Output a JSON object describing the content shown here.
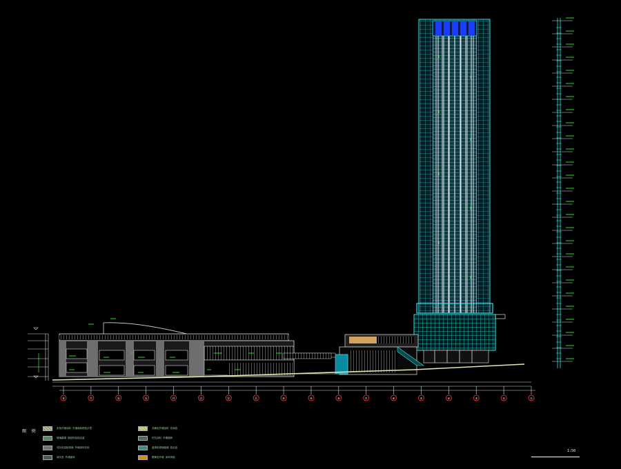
{
  "drawing": {
    "title": "",
    "scale": "1:50",
    "colors": {
      "background": "#000000",
      "tower_frame": "#2ee6e6",
      "tower_panel": "#c8c8c8",
      "crown": "#1a3cff",
      "podium_grey": "#6e6e6e",
      "green_line": "#22e022",
      "annotation": "#e8e8e8",
      "grid_circle": "#ff3b3b",
      "ground": "#e8e6b0"
    }
  },
  "axis_labels": [
    "⑱",
    "⑰",
    "⑯",
    "⑮",
    "⑭",
    "⑬",
    "⑫",
    "⑪",
    "⑩",
    "⑨",
    "⑧",
    "⑦",
    "⑥",
    "⑤",
    "④",
    "③",
    "②",
    "①"
  ],
  "legend": {
    "title": "图 例",
    "items": [
      {
        "label": "米色外墙涂料    外墙面砖颜色示意",
        "color": "#8a9a6a",
        "icon": "hatch"
      },
      {
        "label": "玻璃幕墙 钢结构及铝合金",
        "color": "#5c8a5c",
        "icon": "solid"
      },
      {
        "label": "浅灰色铝板饰面 外墙涂料灰色",
        "color": "#6a7a6a",
        "icon": "solid"
      },
      {
        "label": "深灰色 外墙面砖",
        "color": "#4a5a4a",
        "icon": "solid"
      },
      {
        "label": "浅黄色外墙涂料 花岗岩",
        "color": "#b8b860",
        "icon": "hatch"
      },
      {
        "label": "仿石涂料 外墙面砖",
        "color": "#4a6a5a",
        "icon": "solid"
      },
      {
        "label": "蓝绿色玻璃幕墙 铝合金",
        "color": "#3a8a8a",
        "icon": "solid"
      },
      {
        "label": "橙黄色外墙 涂料饰面",
        "color": "#d88a1a",
        "icon": "solid"
      }
    ]
  }
}
